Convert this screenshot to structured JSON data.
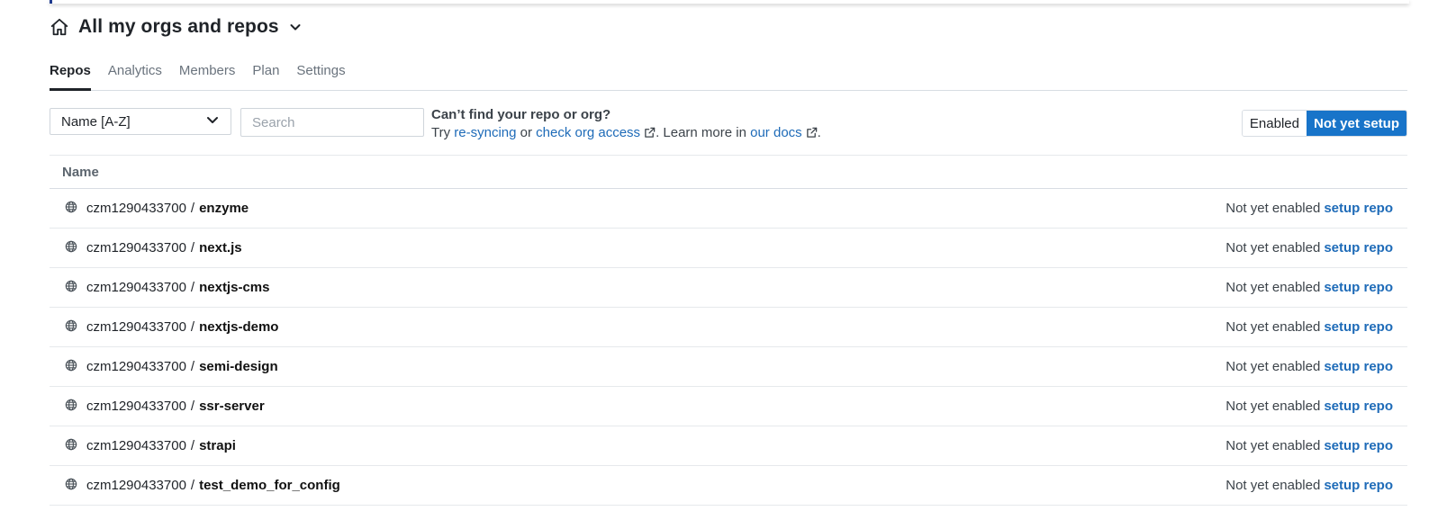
{
  "header": {
    "title": "All my orgs and repos",
    "home_icon": "home-icon",
    "dropdown_icon": "chevron-down-icon"
  },
  "tabs": [
    {
      "label": "Repos",
      "active": true
    },
    {
      "label": "Analytics",
      "active": false
    },
    {
      "label": "Members",
      "active": false
    },
    {
      "label": "Plan",
      "active": false
    },
    {
      "label": "Settings",
      "active": false
    }
  ],
  "controls": {
    "sort_value": "Name [A-Z]",
    "search_placeholder": "Search",
    "help_title": "Can’t find your repo or org?",
    "help_try": "Try ",
    "help_resync": "re-syncing",
    "help_or": " or ",
    "help_access": "check org access",
    "help_learn": ". Learn more in ",
    "help_docs": "our docs",
    "help_end": ".",
    "toggle_enabled": "Enabled",
    "toggle_not_setup": "Not yet setup"
  },
  "table": {
    "column_name": "Name",
    "rows": [
      {
        "org": "czm1290433700",
        "sep": "/",
        "repo": "enzyme",
        "status": "Not yet enabled",
        "action": "setup repo"
      },
      {
        "org": "czm1290433700",
        "sep": "/",
        "repo": "next.js",
        "status": "Not yet enabled",
        "action": "setup repo"
      },
      {
        "org": "czm1290433700",
        "sep": "/",
        "repo": "nextjs-cms",
        "status": "Not yet enabled",
        "action": "setup repo"
      },
      {
        "org": "czm1290433700",
        "sep": "/",
        "repo": "nextjs-demo",
        "status": "Not yet enabled",
        "action": "setup repo"
      },
      {
        "org": "czm1290433700",
        "sep": "/",
        "repo": "semi-design",
        "status": "Not yet enabled",
        "action": "setup repo"
      },
      {
        "org": "czm1290433700",
        "sep": "/",
        "repo": "ssr-server",
        "status": "Not yet enabled",
        "action": "setup repo"
      },
      {
        "org": "czm1290433700",
        "sep": "/",
        "repo": "strapi",
        "status": "Not yet enabled",
        "action": "setup repo"
      },
      {
        "org": "czm1290433700",
        "sep": "/",
        "repo": "test_demo_for_config",
        "status": "Not yet enabled",
        "action": "setup repo"
      }
    ]
  },
  "colors": {
    "accent": "#1874c9",
    "link": "#1e6bb8",
    "text": "#1f2328"
  }
}
